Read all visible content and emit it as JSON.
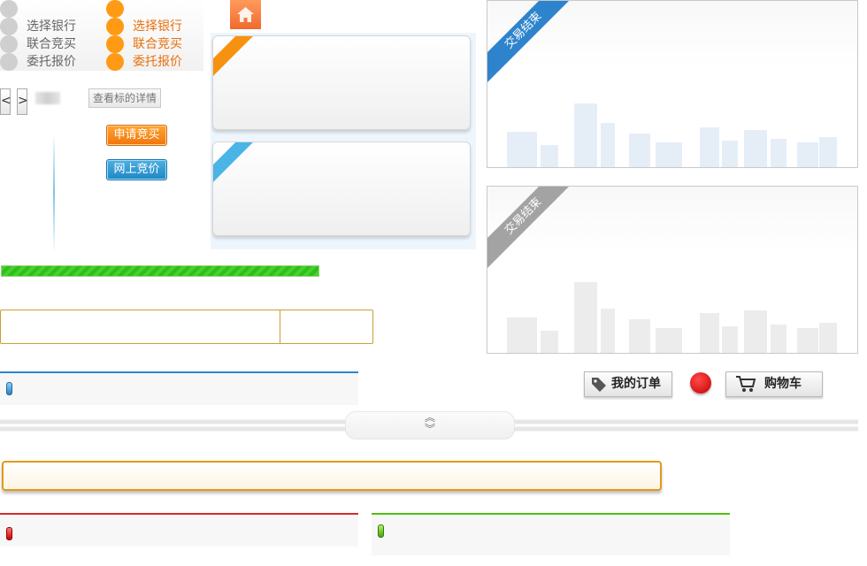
{
  "steps_gray": [
    "选择银行",
    "联合竞买",
    "委托报价"
  ],
  "steps_orange": [
    "选择银行",
    "联合竞买",
    "委托报价"
  ],
  "pager": {
    "prev": "<",
    "next": ">"
  },
  "detail_button": "查看标的详情",
  "buttons": {
    "apply": "申请竞买",
    "online": "网上竞价"
  },
  "panels": [
    {
      "badge": "交易结束",
      "color": "#2e84cc"
    },
    {
      "badge": "交易结束",
      "color": "#a3a3a3"
    }
  ],
  "toolbar": {
    "orders": "我的订单",
    "cart": "购物车"
  },
  "collapse": {
    "up": "︽",
    "down": "︾"
  },
  "progress_percent": 100,
  "colors": {
    "orange": "#ff9a14",
    "blue": "#2e84cc",
    "red": "#d62b2b",
    "green": "#4ec20e"
  }
}
